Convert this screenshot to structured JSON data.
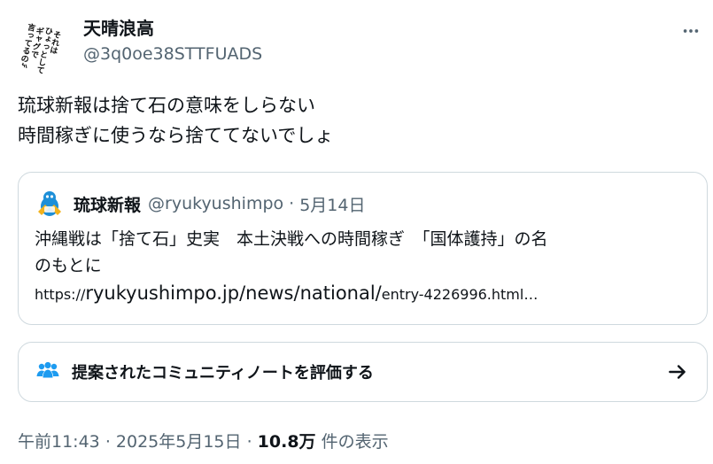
{
  "author": {
    "name": "天晴浪高",
    "handle": "@3q0oe38STTFUADS",
    "avatar_lines": [
      "それは",
      "ひょっとして",
      "ギャグで",
      "言ってるのか"
    ]
  },
  "tweet": {
    "lines": [
      "琉球新報は捨て石の意味をしらない",
      "時間稼ぎに使うなら捨ててないでしょ"
    ]
  },
  "quote": {
    "name": "琉球新報",
    "handle": "@ryukyushimpo",
    "separator": "·",
    "date": "5月14日",
    "lines": [
      "沖縄戦は「捨て石」史実　本土決戦への時間稼ぎ　「国体護持」の名",
      "のもとに"
    ],
    "link_prefix": "https://",
    "link_domain": "ryukyushimpo.jp/news/national/",
    "link_suffix": "entry-4226996.html…"
  },
  "community_note": {
    "label": "提案されたコミュニティノートを評価する"
  },
  "meta": {
    "time": "午前11:43",
    "sep1": "·",
    "date": "2025年5月15日",
    "sep2": "·",
    "views": "10.8万",
    "views_label": "件の表示"
  },
  "colors": {
    "text": "#0f1419",
    "secondary": "#536471",
    "border": "#cfd9de",
    "note_icon": "#1d9bf0"
  },
  "icons": {
    "more": "more-horizontal-icon",
    "note": "community-people-icon",
    "arrow": "arrow-right-icon"
  }
}
